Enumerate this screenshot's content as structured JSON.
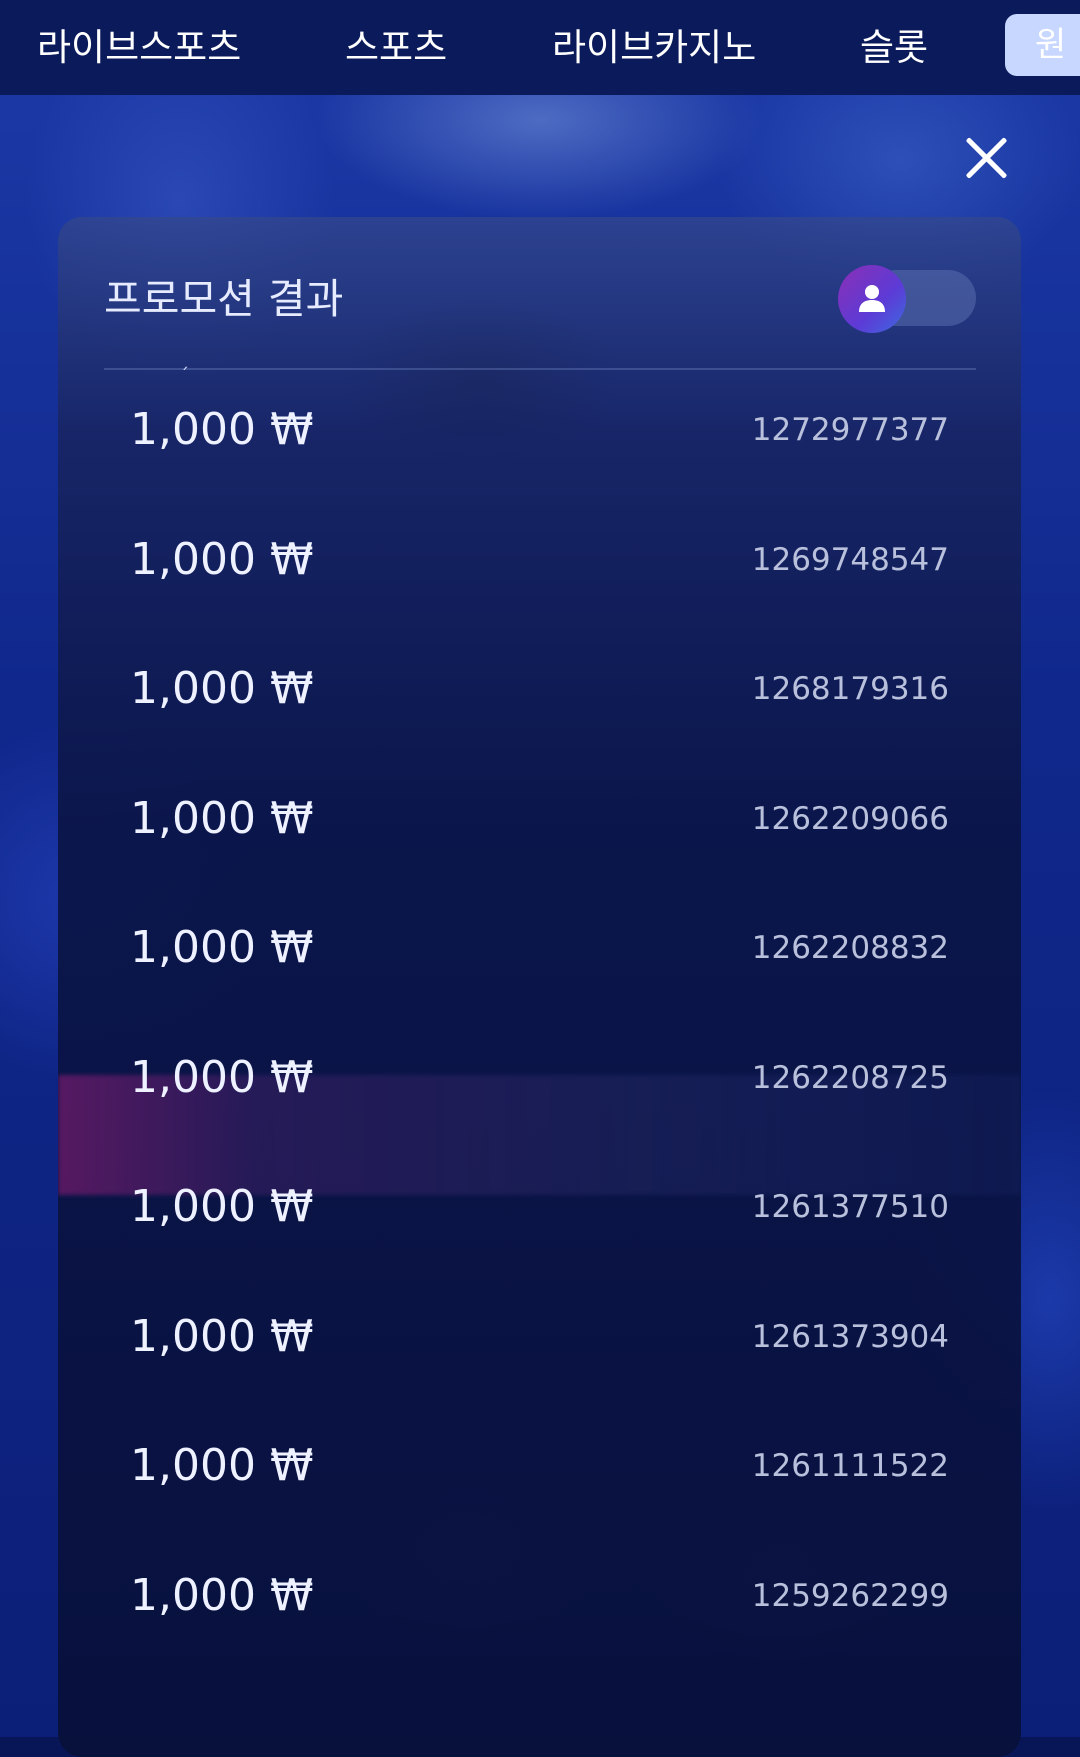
{
  "nav": {
    "items": [
      "라이브스포츠",
      "스포츠",
      "라이브카지노",
      "슬롯"
    ],
    "active_partial": "원"
  },
  "panel": {
    "title": "프로모션 결과"
  },
  "icons": {
    "close": "close-icon",
    "user": "user-icon"
  },
  "rows": [
    {
      "amount": "1,000 ₩",
      "id": "1272977377"
    },
    {
      "amount": "1,000 ₩",
      "id": "1269748547"
    },
    {
      "amount": "1,000 ₩",
      "id": "1268179316"
    },
    {
      "amount": "1,000 ₩",
      "id": "1262209066"
    },
    {
      "amount": "1,000 ₩",
      "id": "1262208832"
    },
    {
      "amount": "1,000 ₩",
      "id": "1262208725"
    },
    {
      "amount": "1,000 ₩",
      "id": "1261377510"
    },
    {
      "amount": "1,000 ₩",
      "id": "1261373904"
    },
    {
      "amount": "1,000 ₩",
      "id": "1261111522"
    },
    {
      "amount": "1,000 ₩",
      "id": "1259262299"
    }
  ],
  "colors": {
    "nav_bg": "#0b1a5a",
    "toggle_gradient_start": "#8b2fb5",
    "toggle_gradient_end": "#3d6be0",
    "active_tab_bg": "#c7d7ff"
  }
}
